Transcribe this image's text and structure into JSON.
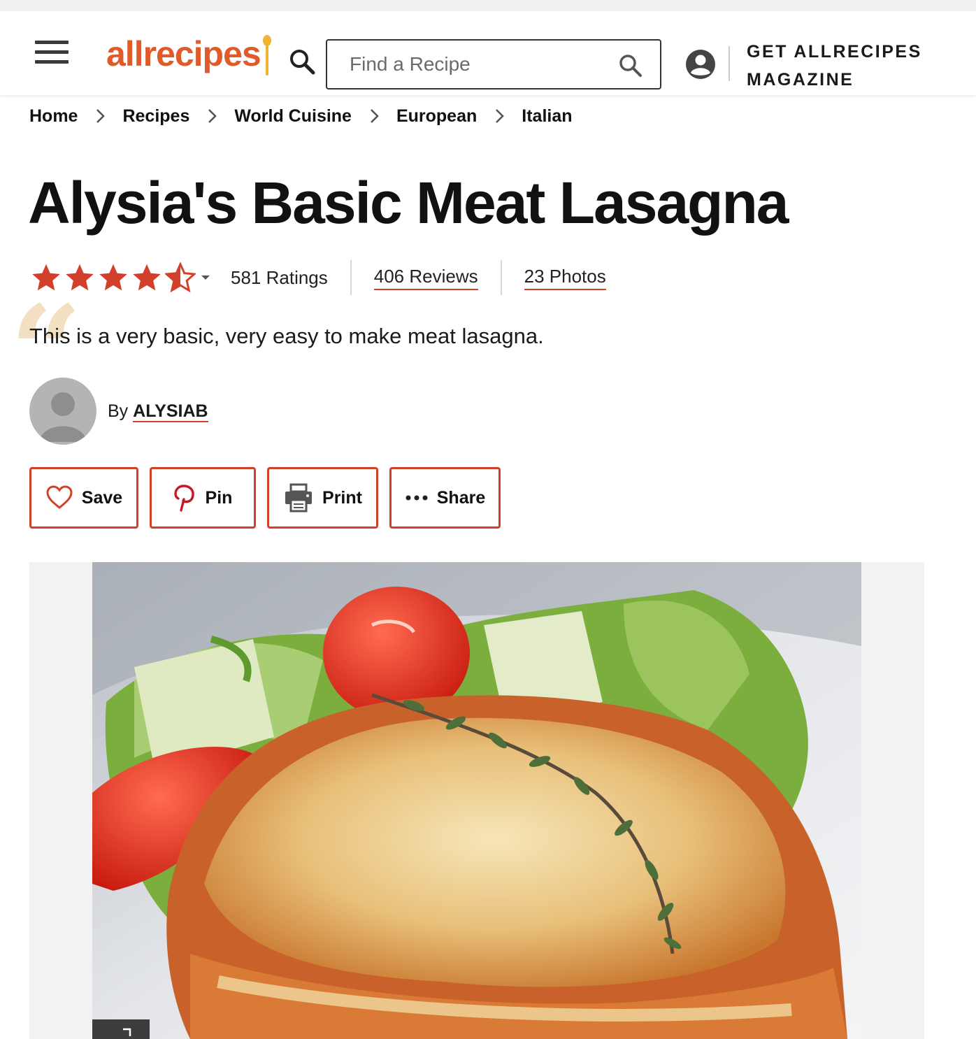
{
  "header": {
    "menu_icon": "hamburger-menu-icon",
    "logo_text": "allrecipes",
    "search_placeholder": "Find a Recipe",
    "search_value": "",
    "account_icon": "user-account-icon",
    "magazine_line1": "GET ALLRECIPES",
    "magazine_line2": "MAGAZINE"
  },
  "breadcrumb": {
    "items": [
      "Home",
      "Recipes",
      "World Cuisine",
      "European",
      "Italian"
    ],
    "separator_icon": "chevron-right-icon"
  },
  "recipe": {
    "title": "Alysia's Basic Meat Lasagna",
    "rating_value": 4.5,
    "rating_max": 5,
    "ratings_label": "581 Ratings",
    "reviews_label": "406 Reviews",
    "photos_label": "23 Photos",
    "description": "This is a very basic, very easy to make meat lasagna.",
    "by_label": "By",
    "author": "ALYSIAB"
  },
  "actions": {
    "save_label": "Save",
    "pin_label": "Pin",
    "print_label": "Print",
    "share_label": "Share"
  },
  "colors": {
    "brand": "#e05a2a",
    "accent_red": "#d2402a",
    "star": "#d2402a",
    "spoon": "#f2b332",
    "quote": "#f3dfc2"
  },
  "photo": {
    "subject": "lasagna-with-salad-photo"
  }
}
